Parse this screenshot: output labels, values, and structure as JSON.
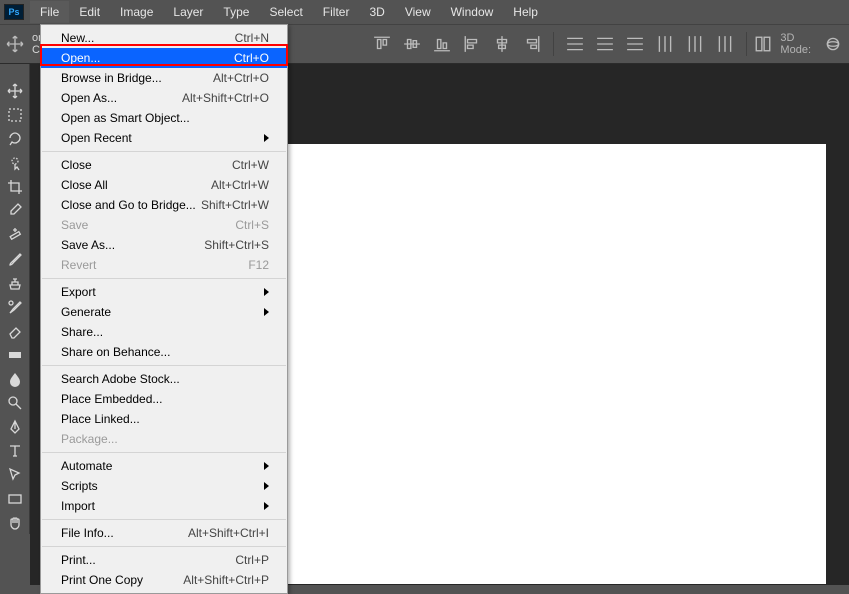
{
  "app": {
    "logo_text": "Ps"
  },
  "menubar": {
    "items": [
      {
        "label": "File"
      },
      {
        "label": "Edit"
      },
      {
        "label": "Image"
      },
      {
        "label": "Layer"
      },
      {
        "label": "Type"
      },
      {
        "label": "Select"
      },
      {
        "label": "Filter"
      },
      {
        "label": "3D"
      },
      {
        "label": "View"
      },
      {
        "label": "Window"
      },
      {
        "label": "Help"
      }
    ]
  },
  "optionsbar": {
    "transform_label": "orm Controls",
    "mode3d_label": "3D Mode:"
  },
  "file_menu": {
    "new": {
      "label": "New...",
      "shortcut": "Ctrl+N"
    },
    "open": {
      "label": "Open...",
      "shortcut": "Ctrl+O"
    },
    "browse": {
      "label": "Browse in Bridge...",
      "shortcut": "Alt+Ctrl+O"
    },
    "open_as": {
      "label": "Open As...",
      "shortcut": "Alt+Shift+Ctrl+O"
    },
    "open_smart": {
      "label": "Open as Smart Object..."
    },
    "open_recent": {
      "label": "Open Recent"
    },
    "close": {
      "label": "Close",
      "shortcut": "Ctrl+W"
    },
    "close_all": {
      "label": "Close All",
      "shortcut": "Alt+Ctrl+W"
    },
    "close_bridge": {
      "label": "Close and Go to Bridge...",
      "shortcut": "Shift+Ctrl+W"
    },
    "save": {
      "label": "Save",
      "shortcut": "Ctrl+S"
    },
    "save_as": {
      "label": "Save As...",
      "shortcut": "Shift+Ctrl+S"
    },
    "revert": {
      "label": "Revert",
      "shortcut": "F12"
    },
    "export": {
      "label": "Export"
    },
    "generate": {
      "label": "Generate"
    },
    "share": {
      "label": "Share..."
    },
    "share_behance": {
      "label": "Share on Behance..."
    },
    "search_stock": {
      "label": "Search Adobe Stock..."
    },
    "place_embedded": {
      "label": "Place Embedded..."
    },
    "place_linked": {
      "label": "Place Linked..."
    },
    "package": {
      "label": "Package..."
    },
    "automate": {
      "label": "Automate"
    },
    "scripts": {
      "label": "Scripts"
    },
    "import": {
      "label": "Import"
    },
    "file_info": {
      "label": "File Info...",
      "shortcut": "Alt+Shift+Ctrl+I"
    },
    "print": {
      "label": "Print...",
      "shortcut": "Ctrl+P"
    },
    "print_one": {
      "label": "Print One Copy",
      "shortcut": "Alt+Shift+Ctrl+P"
    }
  }
}
